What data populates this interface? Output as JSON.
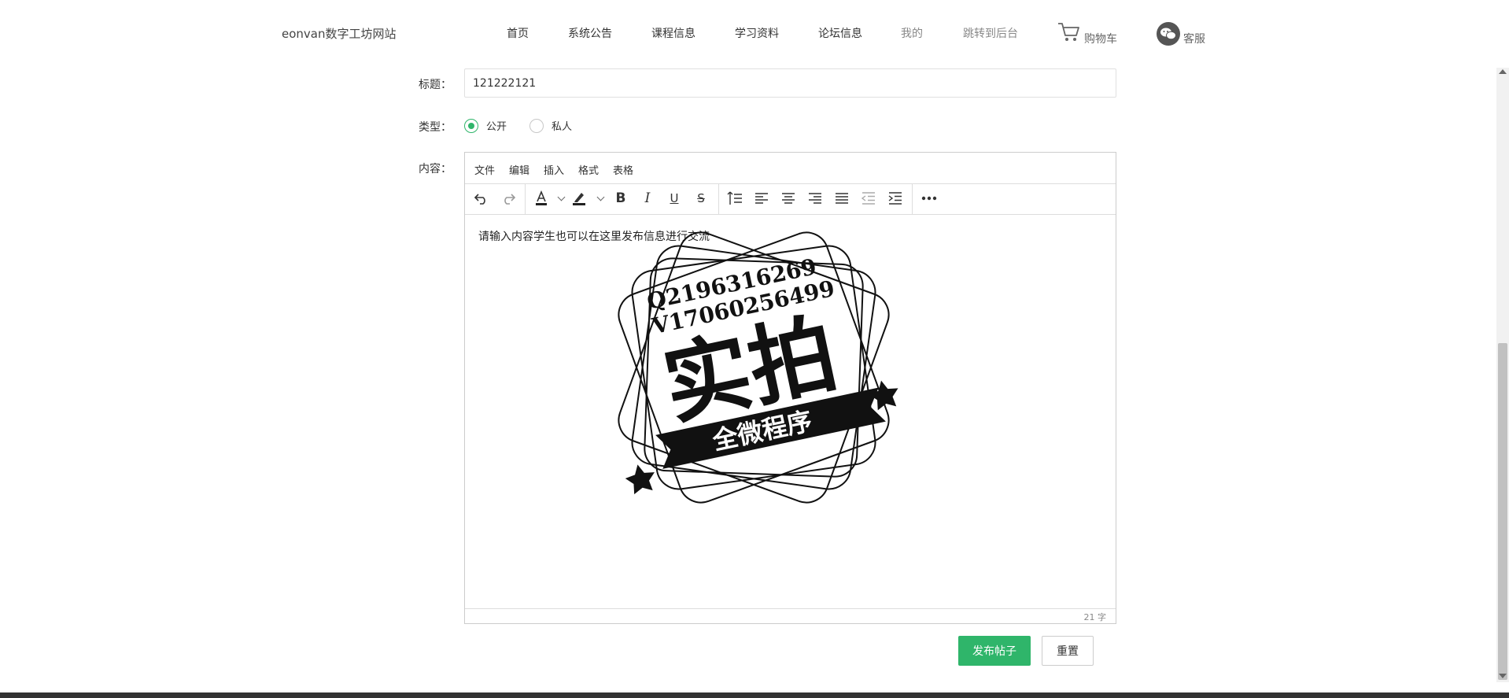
{
  "header": {
    "site_name": "eonvan数字工坊网站",
    "nav": [
      {
        "label": "首页"
      },
      {
        "label": "系统公告"
      },
      {
        "label": "课程信息"
      },
      {
        "label": "学习资料"
      },
      {
        "label": "论坛信息"
      },
      {
        "label": "我的"
      },
      {
        "label": "跳转到后台"
      }
    ],
    "cart_label": "购物车",
    "service_label": "客服"
  },
  "form": {
    "title_label": "标题：",
    "title_value": "121222121",
    "type_label": "类型：",
    "type_options": [
      {
        "label": "公开",
        "checked": true
      },
      {
        "label": "私人",
        "checked": false
      }
    ],
    "content_label": "内容："
  },
  "editor": {
    "menus": [
      "文件",
      "编辑",
      "插入",
      "格式",
      "表格"
    ],
    "toolbar_icons": [
      "undo-icon",
      "redo-icon",
      "text-color-icon",
      "highlight-icon",
      "bold-icon",
      "italic-icon",
      "underline-icon",
      "strikethrough-icon",
      "line-height-icon",
      "align-left-icon",
      "align-center-icon",
      "align-right-icon",
      "align-justify-icon",
      "outdent-icon",
      "indent-icon",
      "more-icon"
    ],
    "content": "请输入内容学生也可以在这里发布信息进行交流",
    "word_count": "21 字"
  },
  "watermark": {
    "line1": "Q2196316269",
    "line2": "V17060256499",
    "main": "实拍",
    "ribbon": "全微程序"
  },
  "buttons": {
    "submit": "发布帖子",
    "reset": "重置"
  },
  "colors": {
    "accent": "#2fb56a",
    "border": "#cccccc"
  }
}
